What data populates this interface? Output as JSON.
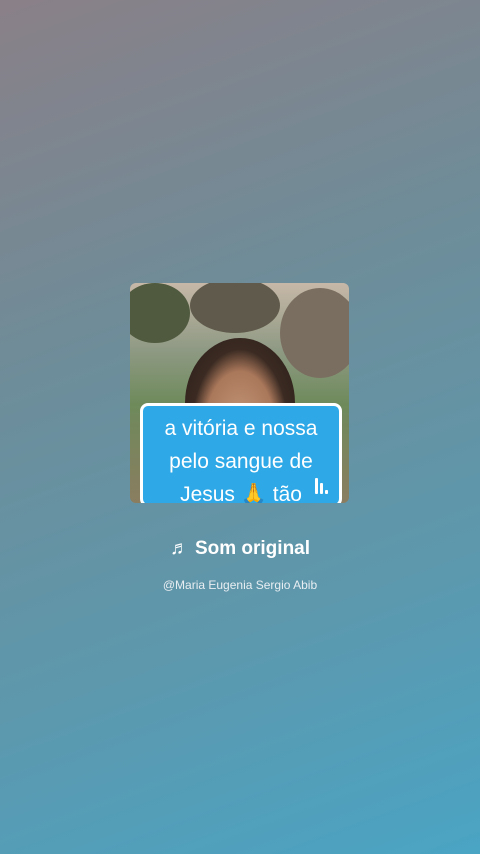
{
  "sound": {
    "title": "Som original",
    "author": "@Maria Eugenia Sergio Abib",
    "note_icon": "♬"
  },
  "thumbnail": {
    "caption_lines": [
      "a vitória e nossa",
      "pelo sangue de",
      "Jesus 🙏 tão"
    ]
  },
  "colors": {
    "caption_bg": "#2ea8e6",
    "text": "#ffffff"
  }
}
